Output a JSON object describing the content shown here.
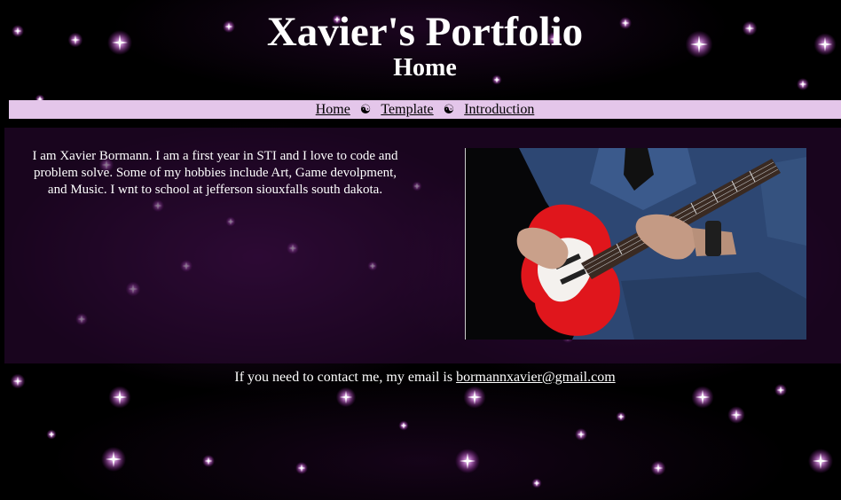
{
  "header": {
    "title": "Xavier's Portfolio",
    "subtitle": "Home"
  },
  "nav": {
    "items": [
      {
        "label": "Home"
      },
      {
        "label": "Template"
      },
      {
        "label": "Introduction"
      }
    ],
    "separator": "☯",
    "background_color": "#e4c6ea"
  },
  "main": {
    "intro": "I am Xavier Bormann. I am a first year in STI and I love to code and problem solve. Some of my hobbies include Art, Game devolpment, and Music. I wnt to school at jefferson siouxfalls south dakota."
  },
  "footer": {
    "contact_prefix": "If you need to contact me, my email is ",
    "email": "bormannxavier@gmail.com"
  },
  "colors": {
    "page_background": "#000000",
    "star_color": "#f2b8f5",
    "text": "#ffffff"
  }
}
